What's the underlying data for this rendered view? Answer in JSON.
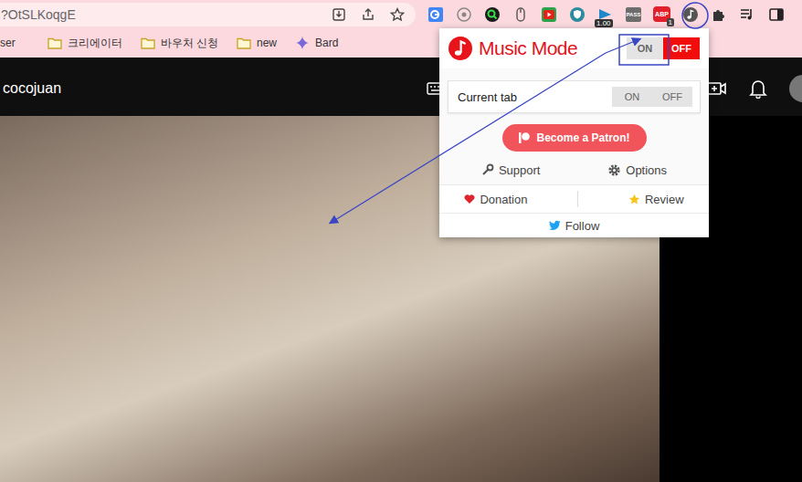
{
  "browser": {
    "address": "?OtSLKoqgE",
    "extensions": [
      {
        "kind": "translate",
        "label": "",
        "badge": ""
      },
      {
        "kind": "flower",
        "label": "",
        "badge": ""
      },
      {
        "kind": "search",
        "label": "",
        "badge": ""
      },
      {
        "kind": "mouse",
        "label": "",
        "badge": ""
      },
      {
        "kind": "video",
        "label": "",
        "badge": ""
      },
      {
        "kind": "shield",
        "label": "",
        "badge": ""
      },
      {
        "kind": "speed",
        "label": "",
        "badge": "1.00"
      },
      {
        "kind": "pass",
        "label": "PASS",
        "badge": ""
      },
      {
        "kind": "abp",
        "label": "ABP",
        "badge": "1"
      },
      {
        "kind": "music",
        "label": "",
        "badge": ""
      },
      {
        "kind": "puzzle",
        "label": "",
        "badge": ""
      }
    ]
  },
  "bookmarks": [
    {
      "label": "ser",
      "kind": "text"
    },
    {
      "label": "크리에이터",
      "kind": "folder"
    },
    {
      "label": "바우처 신청",
      "kind": "folder"
    },
    {
      "label": "new",
      "kind": "folder"
    },
    {
      "label": "Bard",
      "kind": "bard"
    }
  ],
  "youtube": {
    "channel": "cocojuan"
  },
  "popup": {
    "title": "Music Mode",
    "master_toggle": {
      "on_label": "ON",
      "off_label": "OFF",
      "on": false
    },
    "current_tab": {
      "label": "Current tab",
      "on_label": "ON",
      "off_label": "OFF"
    },
    "patron_button": "Become a Patron!",
    "links": [
      {
        "label": "Support",
        "kind": "wrench"
      },
      {
        "label": "Options",
        "kind": "gear"
      }
    ],
    "footer_links": [
      {
        "label": "Donation",
        "kind": "heart"
      },
      {
        "label": "Review",
        "kind": "star"
      }
    ],
    "follow": {
      "label": "Follow"
    }
  }
}
